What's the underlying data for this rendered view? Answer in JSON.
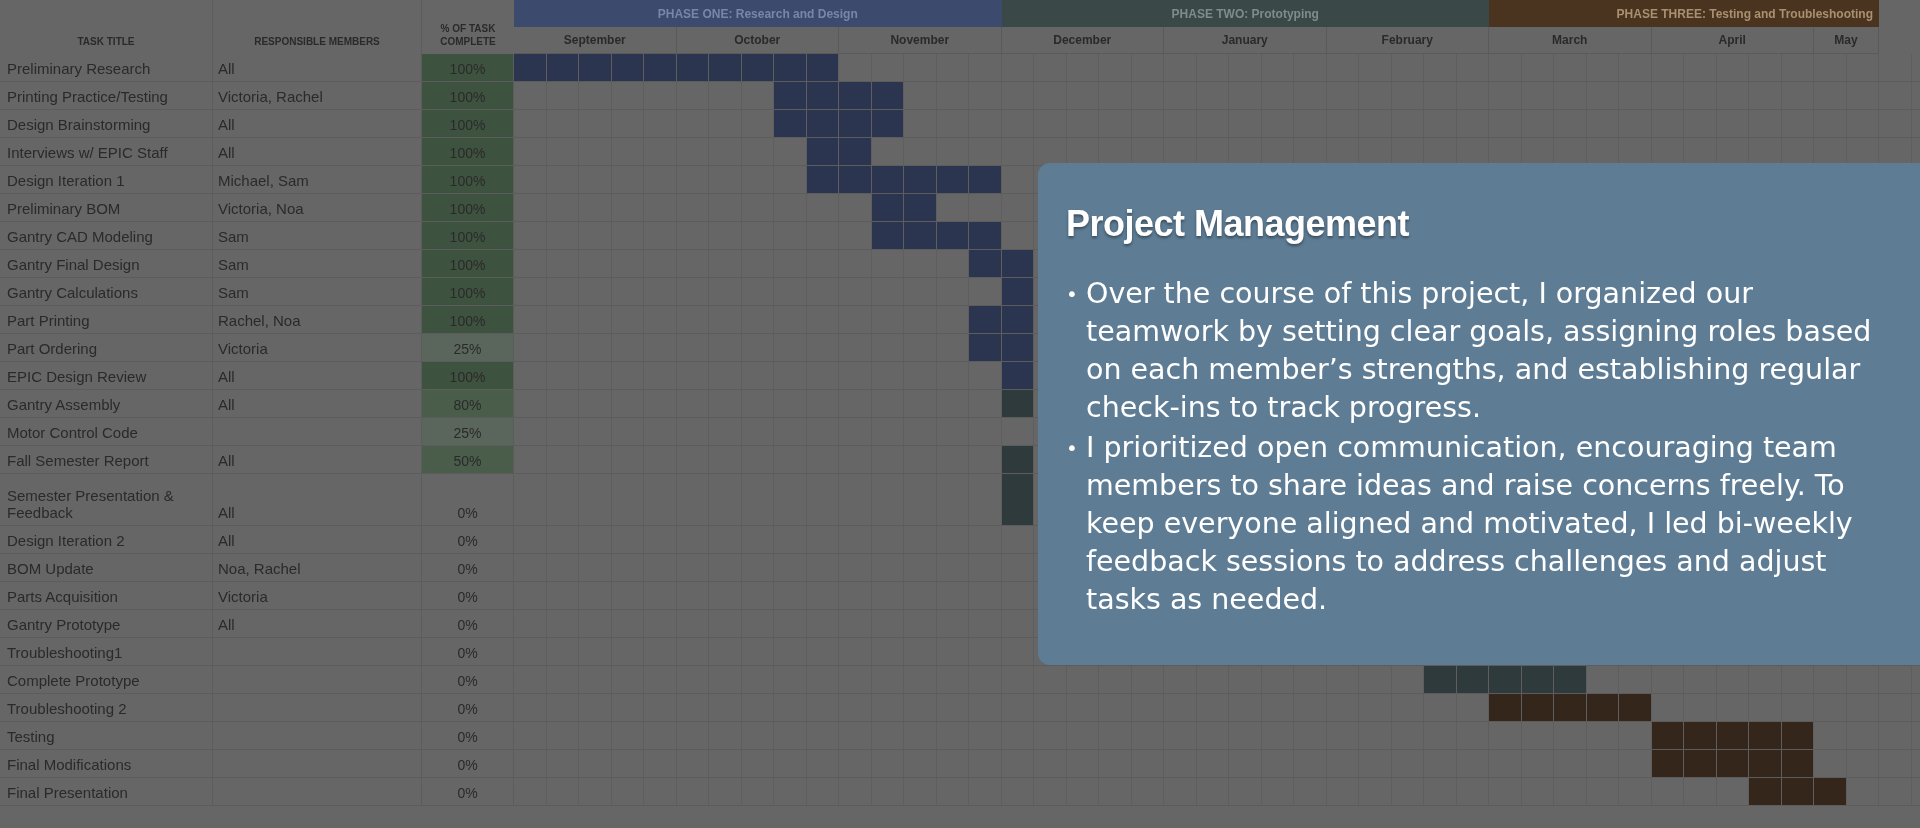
{
  "sheet": {
    "headers": {
      "task": "TASK TITLE",
      "members": "RESPONSIBLE MEMBERS",
      "percent": "% OF TASK COMPLETE"
    },
    "phases": [
      {
        "label": "PHASE ONE: Research and Design",
        "kind": "one",
        "months": [
          "September",
          "October",
          "November"
        ]
      },
      {
        "label": "PHASE TWO: Prototyping",
        "kind": "two",
        "months": [
          "December",
          "January",
          "February"
        ]
      },
      {
        "label": "PHASE THREE: Testing and Troubleshooting",
        "kind": "three",
        "months": [
          "March",
          "April",
          "May"
        ]
      }
    ],
    "rows": [
      {
        "task": "Preliminary Research",
        "members": "All",
        "percent": "100%",
        "kind": "full",
        "bar": {
          "kind": "one",
          "weeks": [
            true,
            true,
            true,
            true,
            true,
            true,
            true,
            true,
            true,
            true
          ]
        }
      },
      {
        "task": "Printing Practice/Testing",
        "members": "Victoria, Rachel",
        "percent": "100%",
        "kind": "full",
        "bar": {
          "kind": "one",
          "weeks": [
            false,
            false,
            false,
            false,
            false,
            false,
            false,
            false,
            true,
            true,
            true,
            true
          ]
        }
      },
      {
        "task": "Design Brainstorming",
        "members": "All",
        "percent": "100%",
        "kind": "full",
        "bar": {
          "kind": "one",
          "weeks": [
            false,
            false,
            false,
            false,
            false,
            false,
            false,
            false,
            true,
            true,
            true,
            true
          ]
        }
      },
      {
        "task": "Interviews w/ EPIC Staff",
        "members": "All",
        "percent": "100%",
        "kind": "full",
        "bar": {
          "kind": "one",
          "weeks": [
            false,
            false,
            false,
            false,
            false,
            false,
            false,
            false,
            false,
            true,
            true
          ]
        }
      },
      {
        "task": "Design Iteration 1",
        "members": "Michael, Sam",
        "percent": "100%",
        "kind": "full",
        "bar": {
          "kind": "one",
          "weeks": [
            false,
            false,
            false,
            false,
            false,
            false,
            false,
            false,
            false,
            true,
            true,
            true,
            true,
            true,
            true
          ]
        }
      },
      {
        "task": "Preliminary BOM",
        "members": "Victoria, Noa",
        "percent": "100%",
        "kind": "full",
        "bar": {
          "kind": "one",
          "weeks": [
            false,
            false,
            false,
            false,
            false,
            false,
            false,
            false,
            false,
            false,
            false,
            true,
            true
          ]
        }
      },
      {
        "task": "Gantry CAD Modeling",
        "members": "Sam",
        "percent": "100%",
        "kind": "full",
        "bar": {
          "kind": "one",
          "weeks": [
            false,
            false,
            false,
            false,
            false,
            false,
            false,
            false,
            false,
            false,
            false,
            true,
            true,
            true,
            true
          ]
        }
      },
      {
        "task": "Gantry Final Design",
        "members": "Sam",
        "percent": "100%",
        "kind": "full",
        "bar": {
          "kind": "one",
          "weeks": [
            false,
            false,
            false,
            false,
            false,
            false,
            false,
            false,
            false,
            false,
            false,
            false,
            false,
            false,
            true,
            true
          ]
        }
      },
      {
        "task": "Gantry Calculations",
        "members": "Sam",
        "percent": "100%",
        "kind": "full",
        "bar": {
          "kind": "one",
          "weeks": [
            false,
            false,
            false,
            false,
            false,
            false,
            false,
            false,
            false,
            false,
            false,
            false,
            false,
            false,
            false,
            true
          ]
        }
      },
      {
        "task": "Part Printing",
        "members": "Rachel, Noa",
        "percent": "100%",
        "kind": "full",
        "bar": {
          "kind": "one",
          "weeks": [
            false,
            false,
            false,
            false,
            false,
            false,
            false,
            false,
            false,
            false,
            false,
            false,
            false,
            false,
            true,
            true
          ]
        }
      },
      {
        "task": "Part Ordering",
        "members": "Victoria",
        "percent": "25%",
        "kind": "low",
        "bar": {
          "kind": "one",
          "weeks": [
            false,
            false,
            false,
            false,
            false,
            false,
            false,
            false,
            false,
            false,
            false,
            false,
            false,
            false,
            true,
            true
          ]
        }
      },
      {
        "task": "EPIC Design Review",
        "members": "All",
        "percent": "100%",
        "kind": "full",
        "bar": {
          "kind": "one",
          "weeks": [
            false,
            false,
            false,
            false,
            false,
            false,
            false,
            false,
            false,
            false,
            false,
            false,
            false,
            false,
            false,
            true
          ]
        }
      },
      {
        "task": "Gantry Assembly",
        "members": "All",
        "percent": "80%",
        "kind": "partial",
        "bar": {
          "kind": "two",
          "weeks": [
            false,
            false,
            false,
            false,
            false,
            false,
            false,
            false,
            false,
            false,
            false,
            false,
            false,
            false,
            false,
            true
          ]
        }
      },
      {
        "task": "Motor Control Code",
        "percent": "25%",
        "kind": "low"
      },
      {
        "task": "Fall Semester Report",
        "members": "All",
        "percent": "50%",
        "kind": "partial",
        "bar": {
          "kind": "two",
          "weeks": [
            false,
            false,
            false,
            false,
            false,
            false,
            false,
            false,
            false,
            false,
            false,
            false,
            false,
            false,
            false,
            true
          ]
        }
      },
      {
        "task": "Semester Presentation & Feedback",
        "members": "All",
        "percent": "0%",
        "kind": "none",
        "bar": {
          "kind": "two",
          "weeks": [
            false,
            false,
            false,
            false,
            false,
            false,
            false,
            false,
            false,
            false,
            false,
            false,
            false,
            false,
            false,
            true
          ]
        }
      },
      {
        "task": "Design Iteration 2",
        "members": "All",
        "percent": "0%",
        "kind": "none"
      },
      {
        "task": "BOM Update",
        "members": "Noa, Rachel",
        "percent": "0%",
        "kind": "none"
      },
      {
        "task": "Parts Acquisition",
        "members": "Victoria",
        "percent": "0%",
        "kind": "none"
      },
      {
        "task": "Gantry Prototype",
        "members": "All",
        "percent": "0%",
        "kind": "none"
      },
      {
        "task": "Troubleshooting1",
        "percent": "0%",
        "kind": "none"
      },
      {
        "task": "Complete Prototype",
        "percent": "0%",
        "kind": "none",
        "bar": {
          "kind": "two",
          "weeks": [
            false,
            false,
            false,
            false,
            false,
            false,
            false,
            false,
            false,
            false,
            false,
            false,
            false,
            false,
            false,
            false,
            false,
            false,
            false,
            false,
            false,
            false,
            false,
            false,
            false,
            false,
            false,
            false,
            true,
            true,
            true,
            true,
            true
          ]
        }
      },
      {
        "task": "Troubleshooting 2",
        "percent": "0%",
        "kind": "none",
        "bar": {
          "kind": "three",
          "weeks": [
            false,
            false,
            false,
            false,
            false,
            false,
            false,
            false,
            false,
            false,
            false,
            false,
            false,
            false,
            false,
            false,
            false,
            false,
            false,
            false,
            false,
            false,
            false,
            false,
            false,
            false,
            false,
            false,
            false,
            false,
            true,
            true,
            true,
            true,
            true
          ]
        }
      },
      {
        "task": "Testing",
        "percent": "0%",
        "kind": "none",
        "bar": {
          "kind": "three",
          "weeks": [
            false,
            false,
            false,
            false,
            false,
            false,
            false,
            false,
            false,
            false,
            false,
            false,
            false,
            false,
            false,
            false,
            false,
            false,
            false,
            false,
            false,
            false,
            false,
            false,
            false,
            false,
            false,
            false,
            false,
            false,
            false,
            false,
            false,
            false,
            false,
            true,
            true,
            true,
            true,
            true
          ]
        }
      },
      {
        "task": "Final Modifications",
        "percent": "0%",
        "kind": "none",
        "bar": {
          "kind": "three",
          "weeks": [
            false,
            false,
            false,
            false,
            false,
            false,
            false,
            false,
            false,
            false,
            false,
            false,
            false,
            false,
            false,
            false,
            false,
            false,
            false,
            false,
            false,
            false,
            false,
            false,
            false,
            false,
            false,
            false,
            false,
            false,
            false,
            false,
            false,
            false,
            false,
            true,
            true,
            true,
            true,
            true
          ]
        }
      },
      {
        "task": "Final Presentation",
        "percent": "0%",
        "kind": "none",
        "bar": {
          "kind": "three",
          "weeks": [
            false,
            false,
            false,
            false,
            false,
            false,
            false,
            false,
            false,
            false,
            false,
            false,
            false,
            false,
            false,
            false,
            false,
            false,
            false,
            false,
            false,
            false,
            false,
            false,
            false,
            false,
            false,
            false,
            false,
            false,
            false,
            false,
            false,
            false,
            false,
            false,
            false,
            false,
            true,
            true,
            true
          ]
        }
      }
    ]
  },
  "card": {
    "title": "Project Management",
    "bullets": [
      {
        "marker": "•",
        "text": "Over the course of this project, I organized our teamwork by setting clear goals, assigning roles based on each member’s strengths, and establishing regular check-ins to track progress."
      },
      {
        "marker": "•",
        "text": "I prioritized open communication, encouraging team members to share ideas and raise concerns freely. To keep everyone aligned and motivated, I led bi-weekly feedback sessions to address challenges and adjust tasks as needed."
      }
    ]
  }
}
